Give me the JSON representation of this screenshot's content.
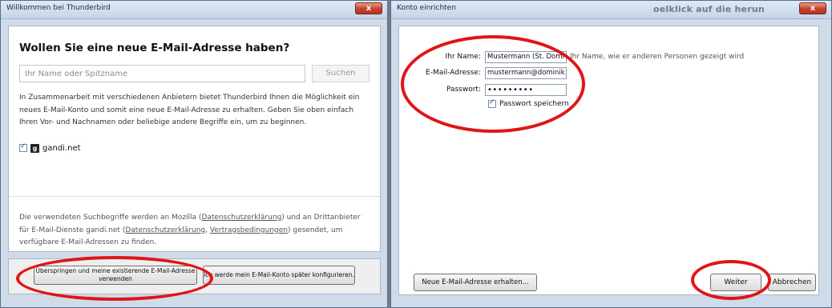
{
  "left_window": {
    "title": "Willkommen bei Thunderbird",
    "close_label": "x",
    "heading": "Wollen Sie eine neue E-Mail-Adresse haben?",
    "search_placeholder": "Ihr Name oder Spitzname",
    "search_button": "Suchen",
    "intro_text": "In Zusammenarbeit mit verschiedenen Anbietern bietet Thunderbird Ihnen die Möglichkeit ein neues E-Mail-Konto und somit eine neue E-Mail-Adresse zu erhalten. Geben Sie oben einfach Ihren Vor- und Nachnamen oder beliebige andere Begriffe ein, um zu beginnen.",
    "provider_name": "gandi.net",
    "provider_checked": true,
    "disclaimer": {
      "part1": "Die verwendeten Suchbegriffe werden an Mozilla (",
      "link1": "Datenschutzerklärung",
      "part2": ") und an Drittanbieter für E-Mail-Dienste gandi.net (",
      "link2": "Datenschutzerklärung",
      "part3": ", ",
      "link3": "Vertragsbedingungen",
      "part4": ") gesendet, um verfügbare E-Mail-Adressen zu finden."
    },
    "skip_button": "Überspringen und meine existierende E-Mail-Adresse verwenden",
    "later_button": "Ich werde mein E-Mail-Konto später konfigurieren."
  },
  "right_window": {
    "title": "Konto einrichten",
    "close_label": "x",
    "behind_text": "oelklick auf die herun",
    "name_label": "Ihr Name:",
    "name_value": "Mustermann (St. Domi",
    "name_hint": "Ihr Name, wie er anderen Personen gezeigt wird",
    "email_label": "E-Mail-Adresse:",
    "email_value": "mustermann@dominik",
    "password_label": "Passwort:",
    "password_value": "•••••••••",
    "save_password_label": "Passwort speichern",
    "save_password_checked": true,
    "new_email_button": "Neue E-Mail-Adresse erhalten...",
    "continue_button": "Weiter",
    "cancel_button": "Abbrechen"
  },
  "colors": {
    "annotation_red": "#e01515",
    "titlebar": "#c4d4e7",
    "close_button": "#c8402c"
  }
}
